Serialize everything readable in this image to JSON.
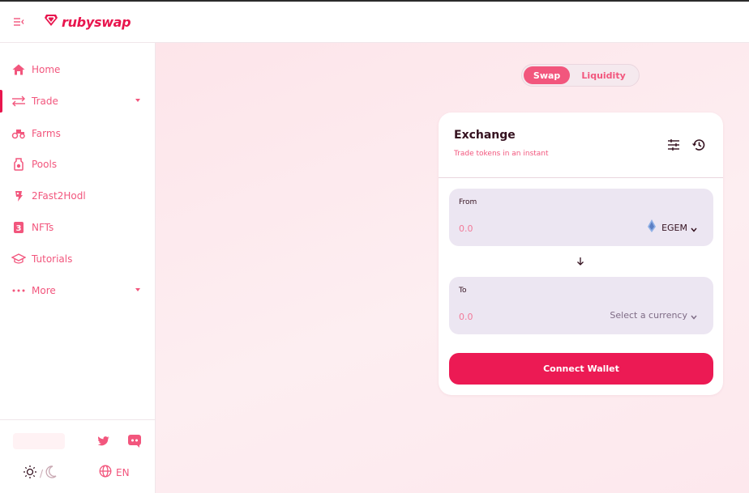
{
  "brand": {
    "name": "rubyswap",
    "accent": "#e8164e",
    "menu_icon": "menu-collapse-icon",
    "logo_icon": "ruby-gem-icon"
  },
  "sidebar": {
    "items": [
      {
        "label": "Home",
        "icon": "home-icon"
      },
      {
        "label": "Trade",
        "icon": "swap-arrows-icon",
        "expandable": true,
        "active": true
      },
      {
        "label": "Farms",
        "icon": "tractor-icon"
      },
      {
        "label": "Pools",
        "icon": "pool-icon"
      },
      {
        "label": "2Fast2Hodl",
        "icon": "racer-icon"
      },
      {
        "label": "NFTs",
        "icon": "nft-icon"
      },
      {
        "label": "Tutorials",
        "icon": "graduation-cap-icon"
      },
      {
        "label": "More",
        "icon": "more-dots-icon",
        "expandable": true
      }
    ],
    "footer": {
      "social": [
        "twitter-icon",
        "discord-icon"
      ],
      "theme": [
        "sun-icon",
        "moon-icon"
      ],
      "theme_separator": "/",
      "language": "EN"
    }
  },
  "main": {
    "tabs": [
      {
        "label": "Swap",
        "selected": true
      },
      {
        "label": "Liquidity",
        "selected": false
      }
    ],
    "card": {
      "title": "Exchange",
      "subtitle": "Trade tokens in an instant",
      "header_icons": [
        "settings-sliders-icon",
        "history-icon"
      ],
      "from": {
        "label": "From",
        "placeholder": "0.0",
        "token": "EGEM",
        "token_icon": "egem-token-icon"
      },
      "to": {
        "label": "To",
        "placeholder": "0.0",
        "token": "Select a currency"
      },
      "switch_icon": "arrow-down-icon",
      "connect_label": "Connect Wallet"
    }
  }
}
